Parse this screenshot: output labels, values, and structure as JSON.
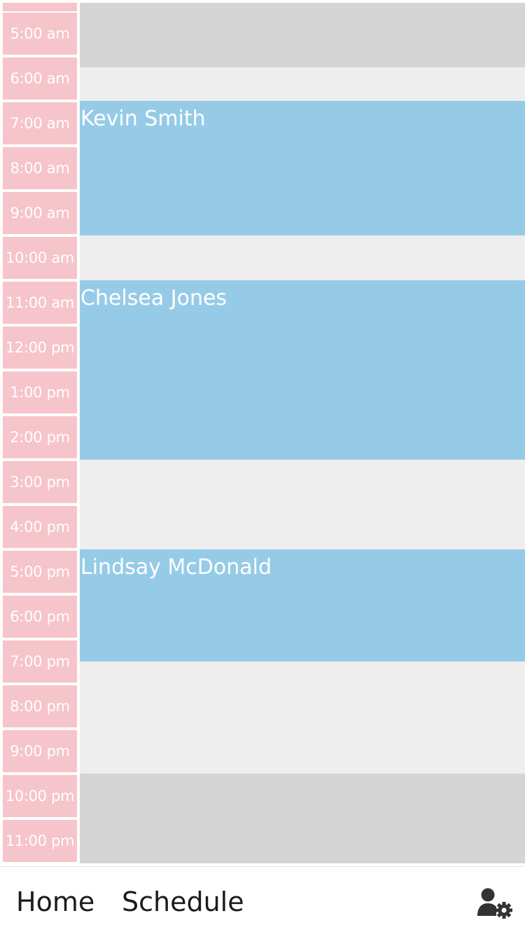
{
  "times": [
    "5:00 am",
    "6:00 am",
    "7:00 am",
    "8:00 am",
    "9:00 am",
    "10:00 am",
    "11:00 am",
    "12:00 pm",
    "1:00 pm",
    "2:00 pm",
    "3:00 pm",
    "4:00 pm",
    "5:00 pm",
    "6:00 pm",
    "7:00 pm",
    "8:00 pm",
    "9:00 pm",
    "10:00 pm",
    "11:00 pm"
  ],
  "shifts": [
    {
      "name": "Kevin Smith",
      "start": "7:00 am",
      "end": "10:00 am"
    },
    {
      "name": "Chelsea Jones",
      "start": "11:00 am",
      "end": "3:00 pm"
    },
    {
      "name": "Lindsay McDonald",
      "start": "5:00 pm",
      "end": "7:30 pm"
    }
  ],
  "nav": {
    "home_label": "Home",
    "schedule_label": "Schedule",
    "settings_icon": "user-gear-icon"
  },
  "colors": {
    "time_cell": "#f6c4cb",
    "shift": "#96cbe7",
    "open_hours": "#eeeeee",
    "closed_hours": "#d4d4d4"
  }
}
